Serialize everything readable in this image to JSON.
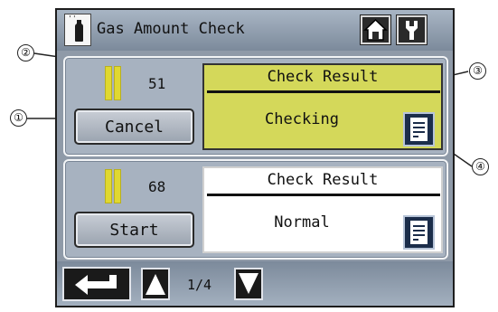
{
  "header": {
    "title": "Gas Amount Check",
    "icon": "gas-cylinder-icon",
    "buttons": [
      "home-icon",
      "wrench-icon"
    ]
  },
  "panels": [
    {
      "amount": "51",
      "button_label": "Cancel",
      "result_label": "Check Result",
      "result_value": "Checking",
      "highlight_color": "#d4d85a"
    },
    {
      "amount": "68",
      "button_label": "Start",
      "result_label": "Check Result",
      "result_value": "Normal",
      "highlight_color": "#ffffff"
    }
  ],
  "footer": {
    "page_indicator": "1/4"
  },
  "callouts": [
    "①",
    "②",
    "③",
    "④"
  ],
  "colors": {
    "screen_bg": "#8f9aa8",
    "gas_cylinder": "#e0d830",
    "doc_button": "#1b2d4a"
  }
}
